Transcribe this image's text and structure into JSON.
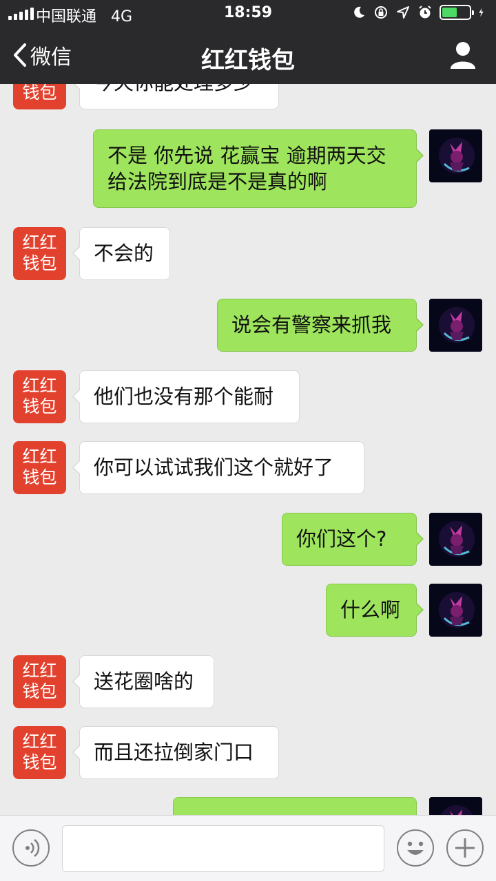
{
  "status_bar": {
    "carrier": "中国联通",
    "network": "4G",
    "time": "18:59",
    "battery_level": 0.55
  },
  "nav": {
    "back_label": "微信",
    "title": "红红钱包"
  },
  "bot_avatar_text": "红红\n钱包",
  "messages": [
    {
      "side": "in",
      "text": "今天你能处理多少"
    },
    {
      "side": "out",
      "text": "不是 你先说 花赢宝 逾期两天交给法院到底是不是真的啊"
    },
    {
      "side": "in",
      "text": "不会的"
    },
    {
      "side": "out",
      "text": "说会有警察来抓我"
    },
    {
      "side": "in",
      "text": "他们也没有那个能耐"
    },
    {
      "side": "in",
      "text": "你可以试试我们这个就好了"
    },
    {
      "side": "out",
      "text": "你们这个?"
    },
    {
      "side": "out",
      "text": "什么啊"
    },
    {
      "side": "in",
      "text": "送花圈啥的"
    },
    {
      "side": "in",
      "text": "而且还拉倒家门口"
    },
    {
      "side": "out",
      "text": ""
    }
  ],
  "input": {
    "value": "",
    "placeholder": ""
  },
  "colors": {
    "top_bar": "#2a2a2c",
    "chat_background": "#ebebeb",
    "outgoing_bubble": "#9ee55d",
    "incoming_bubble": "#ffffff",
    "bot_avatar": "#e2412e"
  },
  "icons": [
    "signal-icon",
    "moon-icon",
    "rotation-lock-icon",
    "location-icon",
    "alarm-icon",
    "battery-icon",
    "charging-icon",
    "back-chevron-icon",
    "profile-icon",
    "voice-icon",
    "emoji-icon",
    "plus-icon"
  ]
}
